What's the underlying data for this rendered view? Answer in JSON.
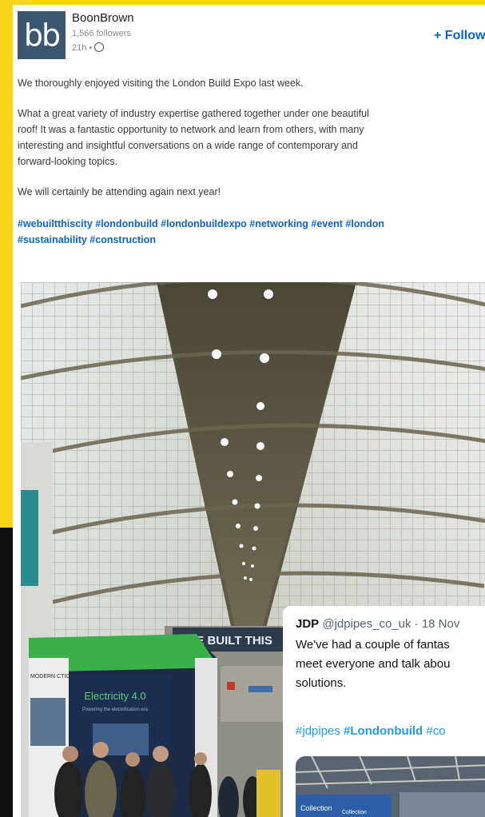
{
  "post": {
    "company_name": "BoonBrown",
    "logo_text": "bb",
    "followers": "1,566 followers",
    "time": "21h •",
    "follow_label": "+ Follow",
    "paragraphs": [
      "We thoroughly enjoyed visiting the London Build Expo last week.",
      "What a great variety of industry expertise gathered together under one beautiful",
      "roof! It was a fantastic opportunity to network and learn from others, with many",
      "interesting and insightful conversations on a wide range of contemporary and",
      "forward-looking topics.",
      "We will certainly be attending again next year!"
    ],
    "hashtags_line1": "#webuiltthiscity #londonbuild #londonbuildexpo #networking #event #london",
    "hashtags_line2": "#sustainability #construction"
  },
  "photo": {
    "banner_text": "WE BUILT THIS",
    "stand_title": "Electricity 4.0",
    "stand_subtitle": "Powering the electrification era",
    "left_sign": "MODERN CTION"
  },
  "tweet": {
    "name": "JDP",
    "handle": "@jdpipes_co_uk · 18 Nov",
    "line1": "We've had a couple of fantas",
    "line2": "meet everyone and talk abou",
    "line3": "solutions.",
    "hashtags_plain": "#jdpipes ",
    "hashtag_bold": "#Londonbuild",
    "hashtags_trail": " #co",
    "photo_label1": "Collection",
    "photo_label2": "Collection"
  },
  "colors": {
    "yellow_bg": "#f7d51d",
    "logo_bg": "#3d566f",
    "link_blue": "#0a66c2",
    "twitter_blue": "#1d9bf0",
    "stand_green": "#3bb04a"
  }
}
